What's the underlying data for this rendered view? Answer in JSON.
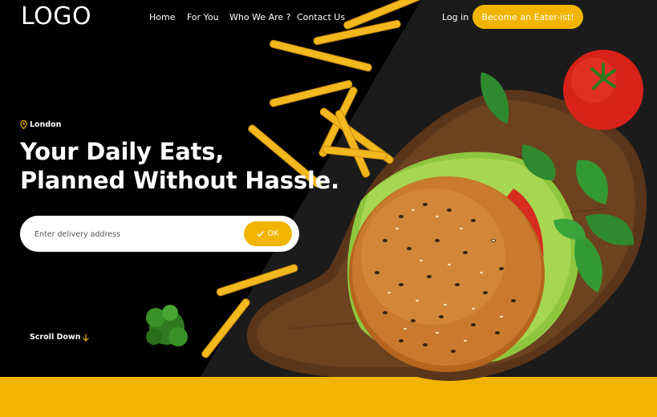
{
  "header": {
    "logo": "LOGO",
    "nav": [
      "Home",
      "For You",
      "Who We Are ?",
      "Contact Us"
    ],
    "login": "Log in",
    "cta": "Become an Eater-ist!"
  },
  "hero": {
    "location": "London",
    "headline_line1": "Your Daily Eats,",
    "headline_line2": "Planned Without Hassle.",
    "search_placeholder": "Enter delivery address",
    "ok_label": "OK",
    "scroll_label": "Scroll Down"
  },
  "icons": {
    "location": "map-pin-icon",
    "ok": "check-icon",
    "scroll": "arrow-down-icon"
  },
  "colors": {
    "accent": "#f1b400",
    "background": "#000000",
    "text": "#ffffff"
  }
}
